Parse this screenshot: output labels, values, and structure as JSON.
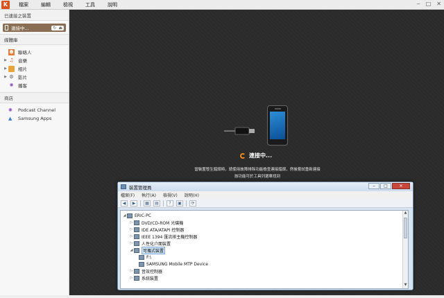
{
  "menubar": {
    "logo": "K",
    "items": [
      "檔案",
      "編輯",
      "檢視",
      "工具",
      "說明"
    ]
  },
  "sidebar": {
    "connected_header": "已連接之裝置",
    "device_label": "連接中...",
    "library_header": "媒體庫",
    "library_items": [
      {
        "label": "聯絡人",
        "icon": "contacts-icon",
        "expandable": false
      },
      {
        "label": "音樂",
        "icon": "music-icon",
        "expandable": true
      },
      {
        "label": "相片",
        "icon": "photo-icon",
        "expandable": true
      },
      {
        "label": "影片",
        "icon": "video-icon",
        "expandable": true
      },
      {
        "label": "播客",
        "icon": "podcast-icon",
        "expandable": false
      }
    ],
    "store_header": "商店",
    "store_items": [
      {
        "label": "Podcast Channel",
        "icon": "podcast-channel-icon"
      },
      {
        "label": "Samsung Apps",
        "icon": "samsung-apps-icon"
      }
    ]
  },
  "main": {
    "connecting_text": "連接中...",
    "message_line1": "當裝置發生錯誤時，請使用故障排除功能檢查連接錯誤，然後嘗試重新連接",
    "message_line2": "該功能可於工具列選單找到"
  },
  "device_manager": {
    "title": "裝置管理員",
    "menu": [
      "檔案(F)",
      "執行(A)",
      "檢視(V)",
      "說明(H)"
    ],
    "tree": [
      {
        "label": "ERIC-PC",
        "indent": 0,
        "exp": "◢"
      },
      {
        "label": "DVD/CD-ROM 光碟機",
        "indent": 1,
        "exp": "▷"
      },
      {
        "label": "IDE ATA/ATAPI 控制器",
        "indent": 1,
        "exp": "▷"
      },
      {
        "label": "IEEE 1394 匯流排主機控制器",
        "indent": 1,
        "exp": "▷"
      },
      {
        "label": "人性化介面裝置",
        "indent": 1,
        "exp": "▷"
      },
      {
        "label": "可攜式裝置",
        "indent": 1,
        "exp": "◢",
        "selected": true
      },
      {
        "label": "F:\\",
        "indent": 2,
        "exp": ""
      },
      {
        "label": "SAMSUNG Mobile MTP Device",
        "indent": 2,
        "exp": ""
      },
      {
        "label": "音效控制器",
        "indent": 1,
        "exp": "▷"
      },
      {
        "label": "系統裝置",
        "indent": 1,
        "exp": "▷"
      }
    ]
  },
  "colors": {
    "accent_orange": "#f08a1c",
    "device_row": "#8a6e54",
    "main_bg": "#2b2b2b"
  }
}
